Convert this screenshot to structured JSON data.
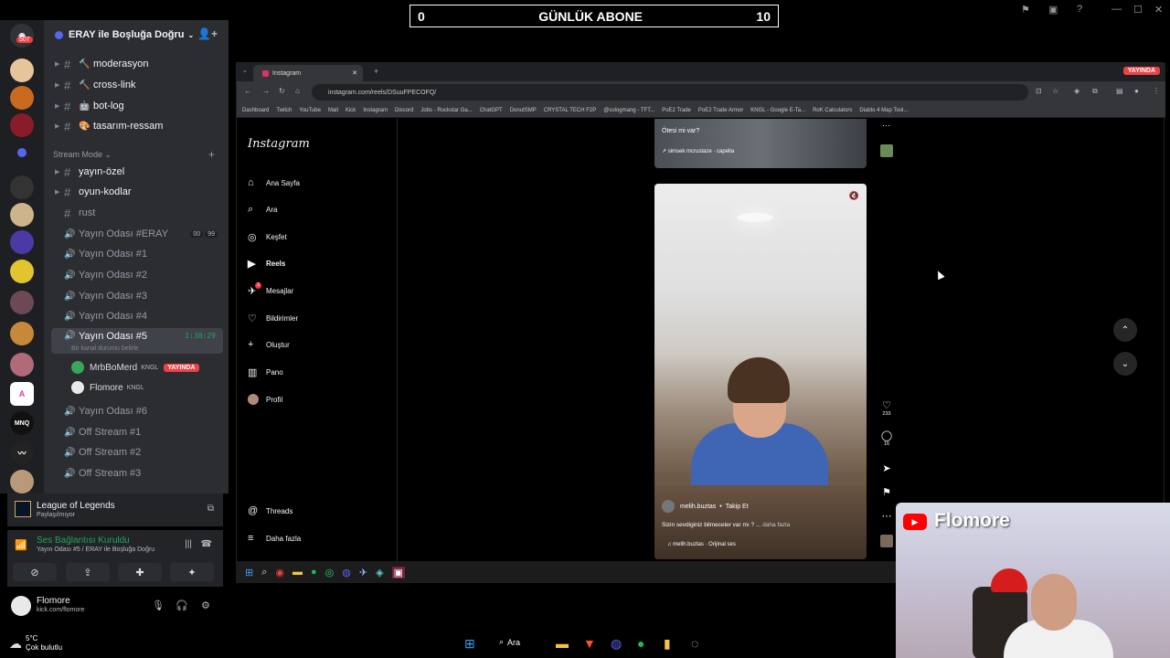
{
  "overlay": {
    "counter_left": "0",
    "counter_label": "GÜNLÜK ABONE",
    "counter_right": "10"
  },
  "discord": {
    "server_badge": "507",
    "server_name": "ERAY ile Boşluğa Doğru",
    "channels_top": [
      "moderasyon",
      "cross-link",
      "bot-log",
      "tasarım-ressam"
    ],
    "category": "Stream Mode",
    "channels_stream": [
      "yayın-özel",
      "oyun-kodlar",
      "rust"
    ],
    "voice_channels_a": [
      "Yayın Odası #ERAY",
      "Yayın Odası #1",
      "Yayın Odası #2",
      "Yayın Odası #3",
      "Yayın Odası #4"
    ],
    "eray_counts": [
      "00",
      "99"
    ],
    "active_channel": "Yayın Odası #5",
    "active_timer": "1:38:29",
    "active_status": "Bir kanal durumu belirle",
    "voice_users": [
      {
        "name": "MrbBoMerd",
        "tag": "KNGL",
        "live": "YAYINDA"
      },
      {
        "name": "Flomore",
        "tag": "KNGL"
      }
    ],
    "voice_channels_b": [
      "Yayın Odası #6",
      "Off Stream #1",
      "Off Stream #2",
      "Off Stream #3"
    ],
    "game_title": "League of Legends",
    "game_sub": "Paylaşılmıyor",
    "voice_connected": "Ses Bağlantısı Kuruldu",
    "voice_where": "Yayın Odası #5 / ERAY ile Boşluğa Doğru",
    "user_name": "Flomore",
    "user_status": "kick.com/flomore"
  },
  "browser": {
    "tab_title": "Instagram",
    "live_badge": "YAYINDA",
    "url": "instagram.com/reels/DSuuFPECOFQ/",
    "bookmarks": [
      "Dashboard",
      "Twitch",
      "YouTube",
      "Mail",
      "Kick",
      "Instagram",
      "Discord",
      "Jobs - Rockstar Ga...",
      "ChatGPT",
      "DonutSMP",
      "CRYSTAL TECH F2P",
      "@sologmang - TFT...",
      "PoE2 Trade",
      "PoE2 Trade Armor",
      "KNGL - Google E-Ta...",
      "RoK Calculators",
      "Diablo 4 Map Tool..."
    ]
  },
  "instagram": {
    "logo": "Instagram",
    "nav": [
      "Ana Sayfa",
      "Ara",
      "Keşfet",
      "Reels",
      "Mesajlar",
      "Bildirimler",
      "Oluştur",
      "Pano",
      "Profil"
    ],
    "messages_badge": "3",
    "threads": "Threads",
    "more": "Daha fazla",
    "prev_caption": "Ötesi mi var?",
    "prev_audio": "↗ simsek mcrustaze · capella",
    "reel_user": "melih.buztas",
    "follow": "Takip Et",
    "caption": "Sizin sevdiginiz bilmeceler var mı ? ...",
    "caption_more": "daha fazla",
    "audio": "melih.buztas · Orijinal ses",
    "likes": "233",
    "comments": "16"
  },
  "webcam": {
    "channel_name": "Flomore"
  },
  "taskbar": {
    "temp": "5°C",
    "weather": "Çok bulutlu",
    "search": "Ara"
  },
  "colors": {
    "discord_bg": "#2b2d31",
    "discord_rail": "#1e1f22",
    "live_red": "#ed4245",
    "voice_green": "#23a55a"
  }
}
